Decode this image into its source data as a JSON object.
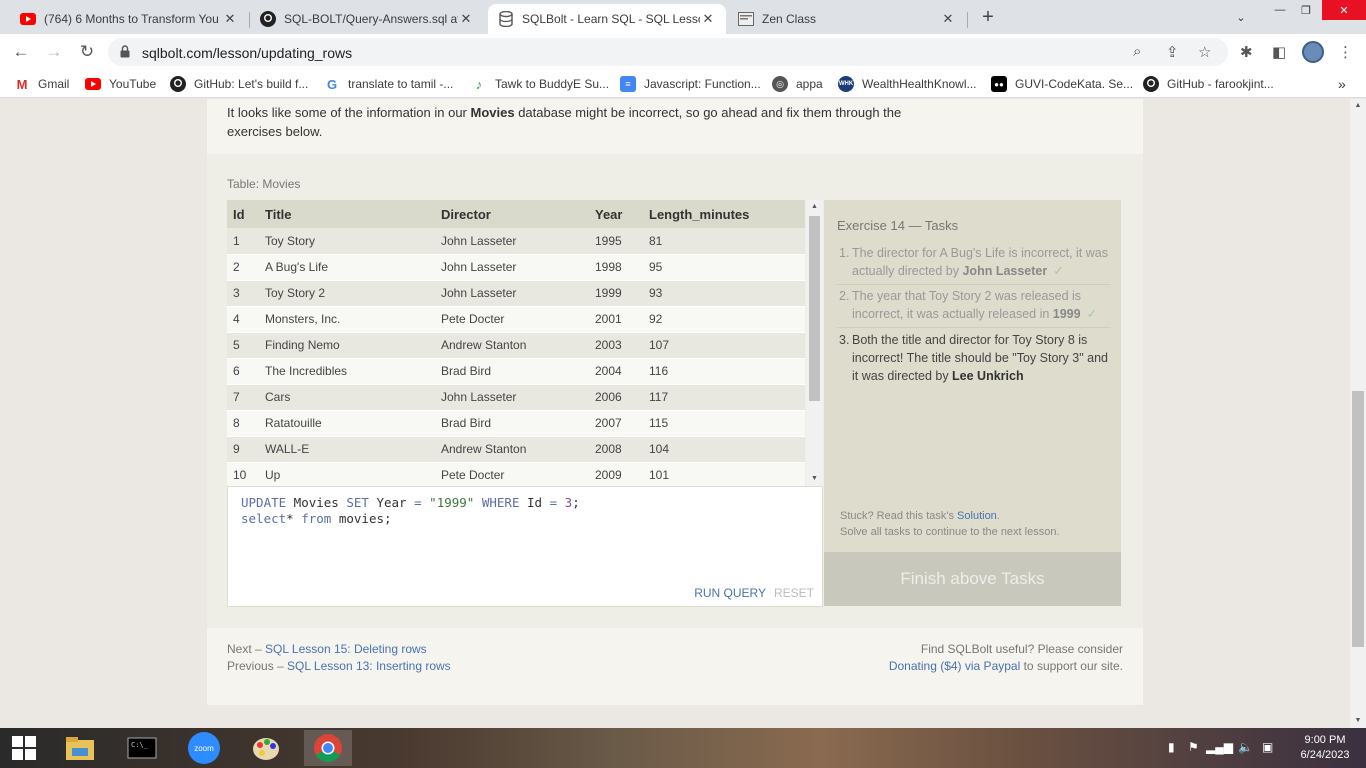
{
  "browser": {
    "tabs": [
      {
        "title": "(764) 6 Months to Transform You",
        "icon": "youtube-icon"
      },
      {
        "title": "SQL-BOLT/Query-Answers.sql at",
        "icon": "github-icon"
      },
      {
        "title": "SQLBolt - Learn SQL - SQL Lesson",
        "icon": "database-icon",
        "active": true
      },
      {
        "title": "Zen Class",
        "icon": "zen-class-icon"
      }
    ],
    "url": "sqlbolt.com/lesson/updating_rows",
    "bookmarks": [
      {
        "label": "Gmail",
        "icon": "gmail-icon"
      },
      {
        "label": "YouTube",
        "icon": "youtube-icon"
      },
      {
        "label": "GitHub: Let's build f...",
        "icon": "github-icon"
      },
      {
        "label": "translate to tamil -...",
        "icon": "google-icon"
      },
      {
        "label": "Tawk to BuddyE Su...",
        "icon": "tawk-icon"
      },
      {
        "label": "Javascript: Function...",
        "icon": "docs-icon"
      },
      {
        "label": "appa",
        "icon": "globe-icon"
      },
      {
        "label": "WealthHealthKnowl...",
        "icon": "wealth-icon"
      },
      {
        "label": "GUVI-CodeKata. Se...",
        "icon": "guvi-icon"
      },
      {
        "label": "GitHub - farookjint...",
        "icon": "github-icon"
      }
    ],
    "bookmarks_overflow": "»"
  },
  "page": {
    "intro_pre": "It looks like some of the information in our ",
    "intro_bold": "Movies",
    "intro_post": " database might be incorrect, so go ahead and fix them through the exercises below.",
    "table_caption": "Table: Movies",
    "columns": [
      "Id",
      "Title",
      "Director",
      "Year",
      "Length_minutes"
    ],
    "rows": [
      [
        "1",
        "Toy Story",
        "John Lasseter",
        "1995",
        "81"
      ],
      [
        "2",
        "A Bug's Life",
        "John Lasseter",
        "1998",
        "95"
      ],
      [
        "3",
        "Toy Story 2",
        "John Lasseter",
        "1999",
        "93"
      ],
      [
        "4",
        "Monsters, Inc.",
        "Pete Docter",
        "2001",
        "92"
      ],
      [
        "5",
        "Finding Nemo",
        "Andrew Stanton",
        "2003",
        "107"
      ],
      [
        "6",
        "The Incredibles",
        "Brad Bird",
        "2004",
        "116"
      ],
      [
        "7",
        "Cars",
        "John Lasseter",
        "2006",
        "117"
      ],
      [
        "8",
        "Ratatouille",
        "Brad Bird",
        "2007",
        "115"
      ],
      [
        "9",
        "WALL-E",
        "Andrew Stanton",
        "2008",
        "104"
      ],
      [
        "10",
        "Up",
        "Pete Docter",
        "2009",
        "101"
      ]
    ],
    "editor": {
      "line1": {
        "kw1": "UPDATE",
        "t1": " Movies ",
        "kw2": "SET",
        "t2": " Year ",
        "op1": "=",
        "t3": " ",
        "str": "\"1999\"",
        "t4": " ",
        "kw3": "WHERE",
        "t5": " Id ",
        "op2": "=",
        "t6": " ",
        "num": "3",
        "t7": ";"
      },
      "line2": {
        "kw1": "select",
        "t1": "* ",
        "kw2": "from",
        "t2": " movies;"
      },
      "run_label": "RUN QUERY",
      "reset_label": "RESET"
    },
    "tasks": {
      "heading": "Exercise 14 — Tasks",
      "items": [
        {
          "num": "1.",
          "text": "The director for A Bug's Life is incorrect, it was actually directed by ",
          "bold": "John Lasseter",
          "done": true
        },
        {
          "num": "2.",
          "text": "The year that Toy Story 2 was released is incorrect, it was actually released in ",
          "bold": "1999",
          "done": true
        },
        {
          "num": "3.",
          "text": "Both the title and director for Toy Story 8 is incorrect! The title should be \"Toy Story 3\" and it was directed by ",
          "bold": "Lee Unkrich",
          "done": false
        }
      ],
      "check": "✓",
      "stuck_pre": "Stuck? Read this task's ",
      "stuck_link": "Solution",
      "stuck_post": ".",
      "solve_all": "Solve all tasks to continue to the next lesson.",
      "finish_label": "Finish above Tasks"
    },
    "footer": {
      "next_prefix": "Next – ",
      "next_link": "SQL Lesson 15: Deleting rows",
      "prev_prefix": "Previous – ",
      "prev_link": "SQL Lesson 13: Inserting rows",
      "right_line1": "Find SQLBolt useful? Please consider",
      "right_link": "Donating ($4) via Paypal",
      "right_post": " to support our site."
    }
  },
  "taskbar": {
    "time": "9:00 PM",
    "date": "6/24/2023",
    "zoom_label": "zoom",
    "apps": [
      "windows-start-icon",
      "file-explorer-icon",
      "command-prompt-icon",
      "zoom-icon",
      "paint-icon",
      "chrome-icon"
    ]
  },
  "colors": {
    "link": "#4a72b0",
    "finish_button": "#c9c8bd",
    "tasks_panel": "#dedccd",
    "table_header": "#d9d9cc"
  }
}
